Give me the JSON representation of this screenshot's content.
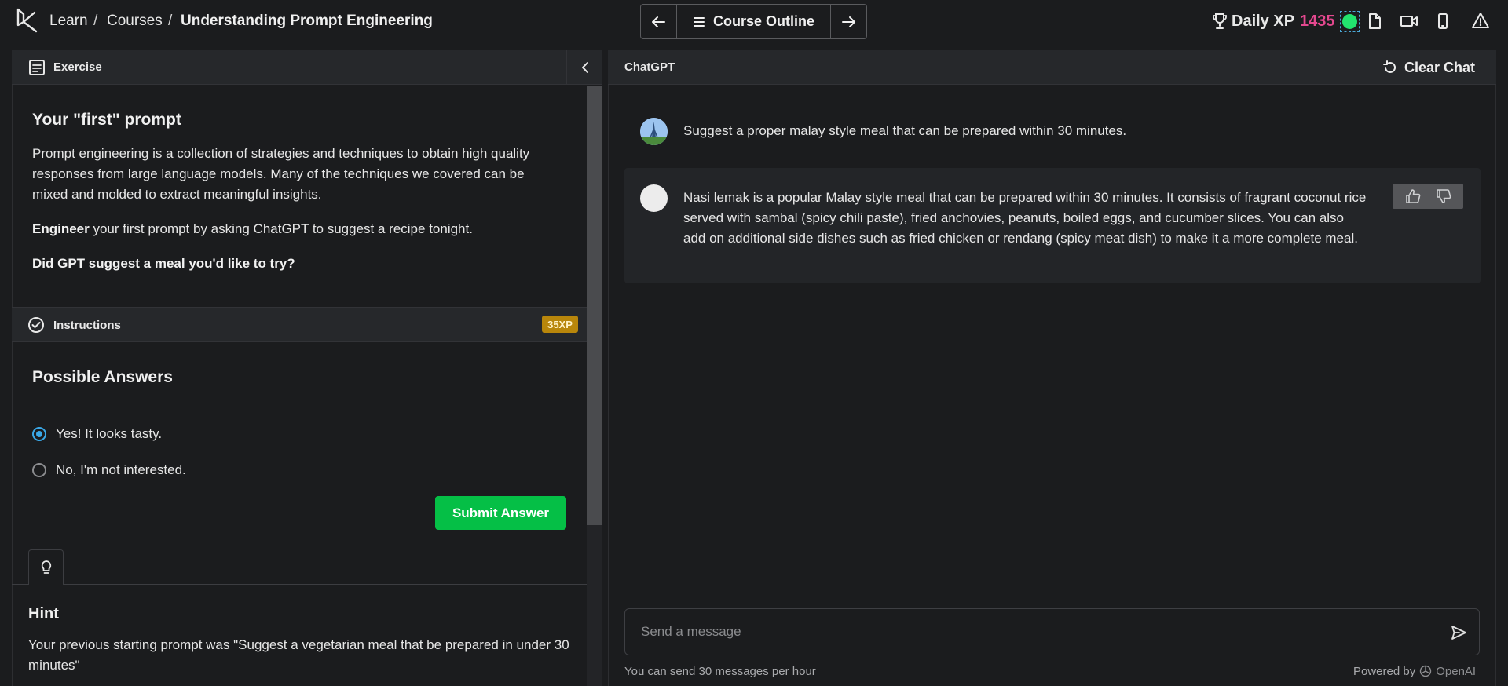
{
  "breadcrumb": {
    "learn": "Learn",
    "sep1": "/",
    "courses": "Courses",
    "sep2": "/",
    "current": "Understanding Prompt Engineering"
  },
  "nav": {
    "outline_label": "Course Outline",
    "prev_icon": "arrow-left-icon",
    "next_icon": "arrow-right-icon"
  },
  "xp": {
    "label": "Daily XP",
    "value": "1435"
  },
  "exercise": {
    "header": "Exercise",
    "title": "Your \"first\" prompt",
    "description": "Prompt engineering is a collection of strategies and techniques to obtain high quality responses from large language models. Many of the techniques we covered can be mixed and molded to extract meaningful insights.",
    "task_bold": "Engineer",
    "task_rest": " your first prompt by asking ChatGPT to suggest a recipe tonight.",
    "question": "Did GPT suggest a meal you'd like to try?"
  },
  "instructions": {
    "header": "Instructions",
    "xp_badge": "35XP",
    "answers_title": "Possible Answers",
    "options": [
      {
        "label": "Yes! It looks tasty.",
        "selected": true
      },
      {
        "label": "No, I'm not interested.",
        "selected": false
      }
    ],
    "submit_label": "Submit Answer"
  },
  "hint": {
    "title": "Hint",
    "text": "Your previous starting prompt was \"Suggest a vegetarian meal that be prepared in under 30 minutes\""
  },
  "chat": {
    "header": "ChatGPT",
    "clear_label": "Clear Chat",
    "user_message": "Suggest a proper malay style meal that can be prepared within 30 minutes.",
    "assistant_message": "Nasi lemak is a popular Malay style meal that can be prepared within 30 minutes. It consists of fragrant coconut rice served with sambal (spicy chili paste), fried anchovies, peanuts, boiled eggs, and cucumber slices. You can also add on additional side dishes such as fried chicken or rendang (spicy meat dish) to make it a more complete meal.",
    "input_placeholder": "Send a message",
    "limit_note": "You can send 30 messages per hour",
    "powered_by": "Powered by",
    "provider": "OpenAI"
  },
  "colors": {
    "accent_green": "#05bf46",
    "xp_pink": "#e4488f",
    "xp_badge": "#b8860b",
    "radio_blue": "#3aa8e8",
    "status_green": "#22e36e"
  }
}
